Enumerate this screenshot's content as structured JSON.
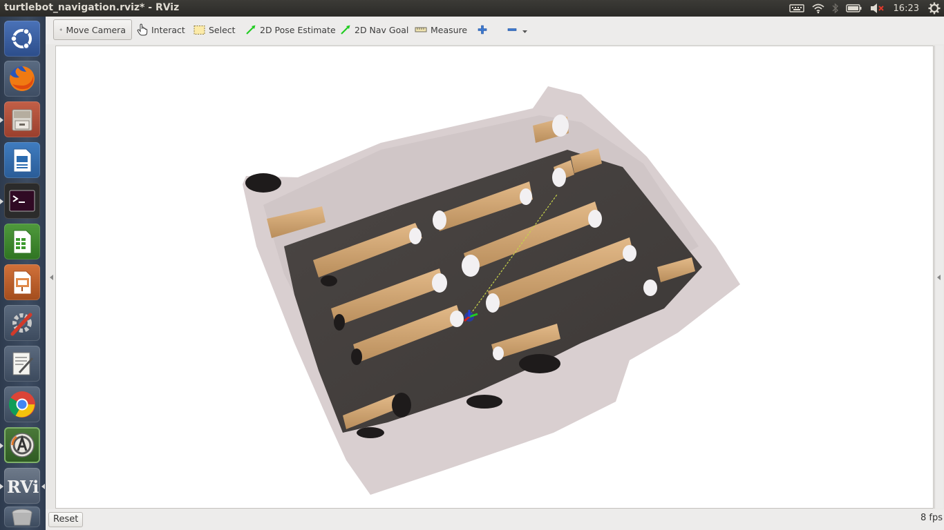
{
  "window": {
    "title": "turtlebot_navigation.rviz* - RViz"
  },
  "panel": {
    "clock": "16:23",
    "indicators": [
      "keyboard-icon",
      "wifi-icon",
      "bluetooth-icon",
      "battery-icon",
      "volume-muted-icon",
      "settings-gear-icon"
    ]
  },
  "launcher": {
    "items": [
      {
        "name": "ubuntu-dash",
        "icon": "ubuntu-logo-icon"
      },
      {
        "name": "firefox",
        "icon": "firefox-icon"
      },
      {
        "name": "files",
        "icon": "file-cabinet-icon"
      },
      {
        "name": "libreoffice-writer",
        "icon": "writer-document-icon"
      },
      {
        "name": "terminal",
        "icon": "terminal-icon"
      },
      {
        "name": "libreoffice-calc",
        "icon": "calc-spreadsheet-icon"
      },
      {
        "name": "libreoffice-impress",
        "icon": "impress-presentation-icon"
      },
      {
        "name": "system-settings",
        "icon": "settings-tools-icon"
      },
      {
        "name": "text-editor",
        "icon": "text-editor-icon"
      },
      {
        "name": "chrome",
        "icon": "chrome-icon"
      },
      {
        "name": "software-updater",
        "icon": "software-updater-icon"
      },
      {
        "name": "rviz",
        "icon": "rviz-icon",
        "label": "RViz"
      },
      {
        "name": "trash",
        "icon": "trash-icon"
      }
    ]
  },
  "toolbar": {
    "move_camera": "Move Camera",
    "interact": "Interact",
    "select": "Select",
    "pose_estimate": "2D Pose Estimate",
    "nav_goal": "2D Nav Goal",
    "measure": "Measure"
  },
  "statusbar": {
    "reset": "Reset",
    "fps": "8 fps"
  },
  "colors": {
    "accent_green": "#22cc22",
    "launcher_bg": "#3d4c61",
    "panel_bg": "#3c3b37"
  }
}
